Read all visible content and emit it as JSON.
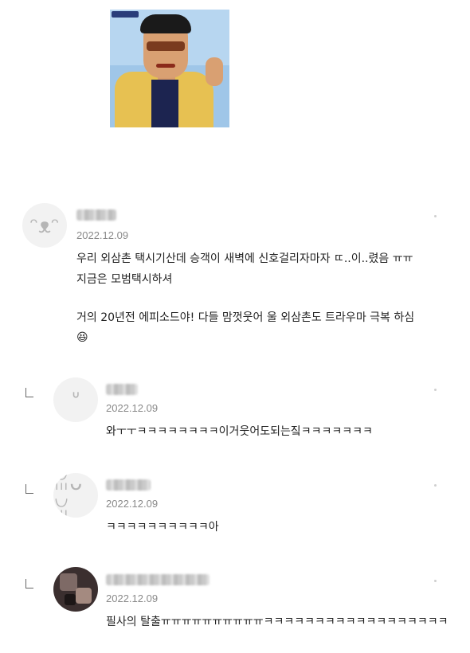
{
  "comments": [
    {
      "date": "2022.12.09",
      "lines": [
        "우리 외삼촌 택시기산데 승객이 새벽에 신호걸리자마자 ㄸ..이..렸음 ㅠㅠ",
        "지금은 모범택시하셔",
        "",
        "거의 20년전 에피소드야! 다들 맘껏웃어 울 외삼촌도 트라우마 극복 하심"
      ],
      "emoji": "😆",
      "avatar_icon": "ghost-character-icon"
    },
    {
      "date": "2022.12.09",
      "text": "와ㅜㅜㅋㅋㅋㅋㅋㅋㅋㅋ이거웃어도되는짘ㅋㅋㅋㅋㅋㅋㅋ",
      "avatar_icon": "dinosaur-character-icon"
    },
    {
      "date": "2022.12.09",
      "text": "ㅋㅋㅋㅋㅋㅋㅋㅋㅋㅋ아",
      "avatar_icon": "rabbit-character-icon"
    },
    {
      "date": "2022.12.09",
      "text": "필사의 탈출ㅠㅠㅠㅠㅠㅠㅠㅠㅠㅠㅋㅋㅋㅋㅋㅋㅋㅋㅋㅋㅋㅋㅋㅋㅋㅋㅋㅋ",
      "avatar_icon": "profile-photo"
    }
  ]
}
